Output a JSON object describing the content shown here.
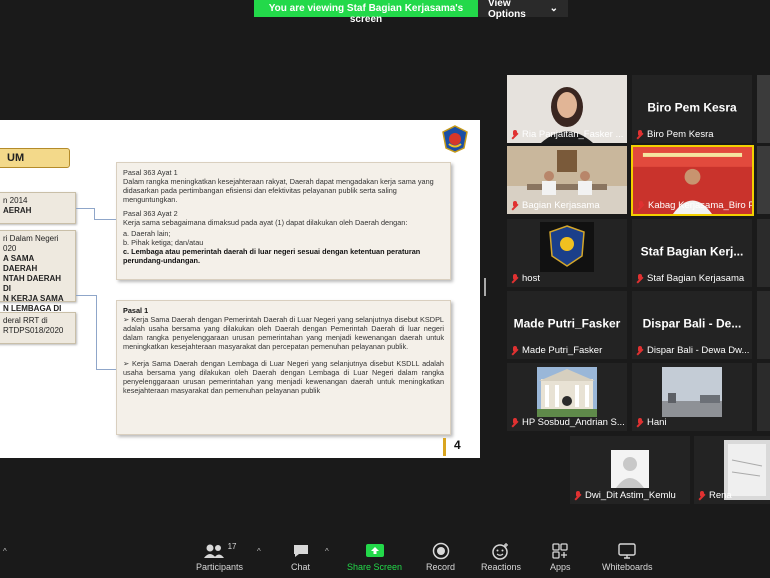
{
  "banner": {
    "text": "You are viewing Staf Bagian Kerjasama's screen",
    "options_label": "View Options"
  },
  "slide": {
    "title": "UM",
    "left_boxes": [
      {
        "lines": [
          "n 2014",
          "AERAH"
        ]
      },
      {
        "lines": [
          "ri Dalam Negeri",
          "020",
          "A SAMA DAERAH",
          "NTAH DAERAH DI",
          "N KERJA SAMA",
          "N LEMBAGA DI"
        ]
      },
      {
        "lines": [
          "deral RRT di",
          "RTDPS018/2020"
        ]
      }
    ],
    "box1": {
      "p1_title": "Pasal 363 Ayat 1",
      "p1_text": "Dalam rangka meningkatkan kesejahteraan rakyat, Daerah dapat mengadakan kerja sama yang didasarkan pada pertimbangan efisiensi dan efektivitas pelayanan publik serta saling menguntungkan.",
      "p2_title": "Pasal 363 Ayat 2",
      "p2_text": "Kerja sama sebagaimana dimaksud pada ayat (1) dapat dilakukan oleh Daerah dengan:",
      "item_a": "a.  Daerah lain;",
      "item_b": "b.  Pihak ketiga; dan/atau",
      "item_c": "c.  Lembaga atau pemerintah daerah di luar negeri sesuai dengan ketentuan peraturan perundang-undangan."
    },
    "box2": {
      "title": "Pasal 1",
      "para1": "➢  Kerja Sama Daerah dengan Pemerintah Daerah di Luar Negeri yang selanjutnya disebut KSDPL adalah usaha bersama yang dilakukan oleh Daerah dengan Pemerintah Daerah di luar negeri dalam rangka penyelenggaraan urusan pemerintahan yang menjadi kewenangan daerah untuk meningkatkan kesejahteraan masyarakat dan percepatan pemenuhan pelayanan publik.",
      "para2": "➢  Kerja Sama Daerah dengan Lembaga di Luar Negeri yang selanjutnya disebut KSDLL adalah usaha bersama yang dilakukan oleh Daerah dengan Lembaga di Luar Negeri dalam rangka penyelenggaraan urusan pemerintahan yang menjadi kewenangan daerah untuk meningkatkan kesejahteraan masyarakat dan pemenuhan pelayanan publik"
    },
    "page_number": "4"
  },
  "participants_tiles": [
    {
      "name": "Ria Panjaitan_Fasker ...",
      "center": ""
    },
    {
      "name": "Biro Pem Kesra",
      "center": "Biro Pem Kesra"
    },
    {
      "name": "Bagian Kerjasama",
      "center": ""
    },
    {
      "name": "Kabag Kerjasama_Biro P...",
      "center": ""
    },
    {
      "name": "host",
      "center": ""
    },
    {
      "name": "Staf Bagian Kerjasama",
      "center": "Staf Bagian Kerj..."
    },
    {
      "name": "Made Putri_Fasker",
      "center": "Made Putri_Fasker"
    },
    {
      "name": "Dispar Bali - Dewa Dw...",
      "center": "Dispar Bali - De..."
    },
    {
      "name": "HP Sosbud_Andrian S...",
      "center": ""
    },
    {
      "name": "Hani",
      "center": ""
    },
    {
      "name": "Dwi_Dit Astim_Kemlu",
      "center": ""
    },
    {
      "name": "Rena",
      "center": ""
    }
  ],
  "toolbar": {
    "participants_label": "Participants",
    "participants_count": "17",
    "chat_label": "Chat",
    "share_label": "Share Screen",
    "record_label": "Record",
    "reactions_label": "Reactions",
    "apps_label": "Apps",
    "whiteboards_label": "Whiteboards"
  },
  "colors": {
    "share_green": "#23d94a",
    "active_border": "#f2d000",
    "muted_red": "#e03131"
  }
}
